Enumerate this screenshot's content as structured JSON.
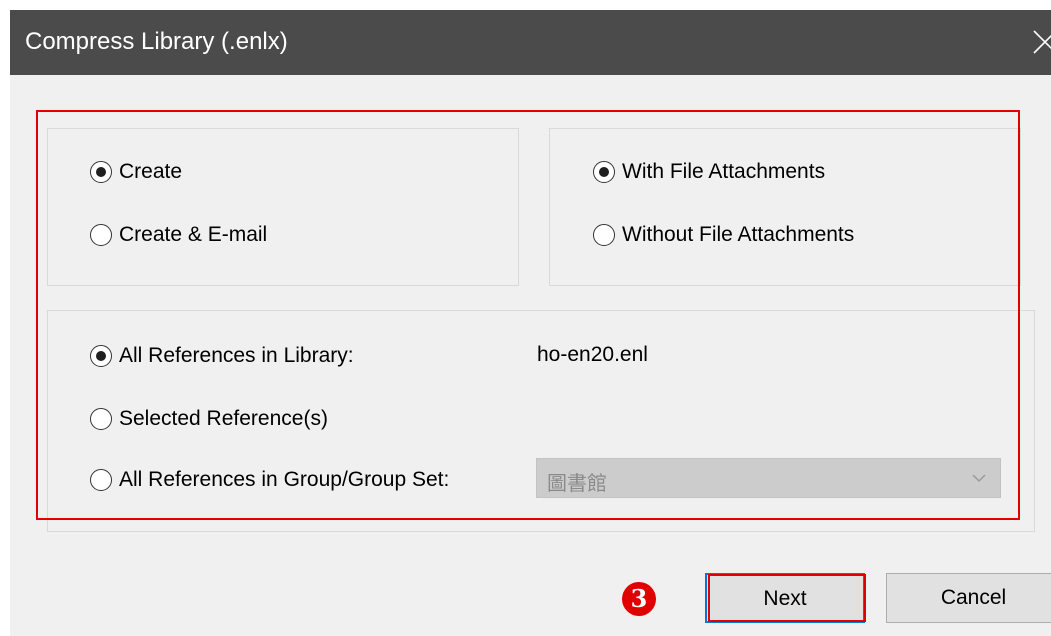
{
  "window": {
    "title": "Compress Library (.enlx)",
    "close_glyph": "✕"
  },
  "action_group": {
    "options": [
      {
        "label": "Create",
        "checked": true
      },
      {
        "label": "Create & E-mail",
        "checked": false
      }
    ]
  },
  "attachment_group": {
    "options": [
      {
        "label": "With File Attachments",
        "checked": true
      },
      {
        "label": "Without File Attachments",
        "checked": false
      }
    ]
  },
  "reference_group": {
    "options": [
      {
        "label": "All References in Library:",
        "checked": true
      },
      {
        "label": "Selected Reference(s)",
        "checked": false
      },
      {
        "label": "All References in Group/Group Set:",
        "checked": false
      }
    ],
    "library_file": "ho-en20.enl",
    "group_select": {
      "value": "圖書館",
      "disabled": true
    }
  },
  "buttons": {
    "next": "Next",
    "cancel": "Cancel"
  },
  "annotation": {
    "step_number": "3",
    "highlight_color": "#e00000"
  },
  "colors": {
    "titlebar": "#4b4b4b",
    "dialog_background": "#f0f0f0",
    "focus_border": "#0078d7"
  }
}
